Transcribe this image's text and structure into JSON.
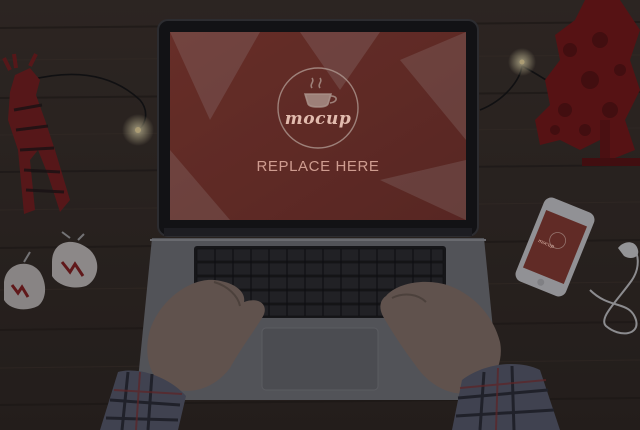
{
  "screen": {
    "logo_text": "mocup",
    "caption": "REPLACE HERE",
    "icon": "coffee-cup-icon"
  },
  "phone": {
    "logo_text": "mocup"
  },
  "colors": {
    "table": "#3b2f27",
    "screen": "#8e3b30",
    "ornament_red": "#8a1b1b",
    "overlay": "rgba(15,15,20,0.55)"
  }
}
